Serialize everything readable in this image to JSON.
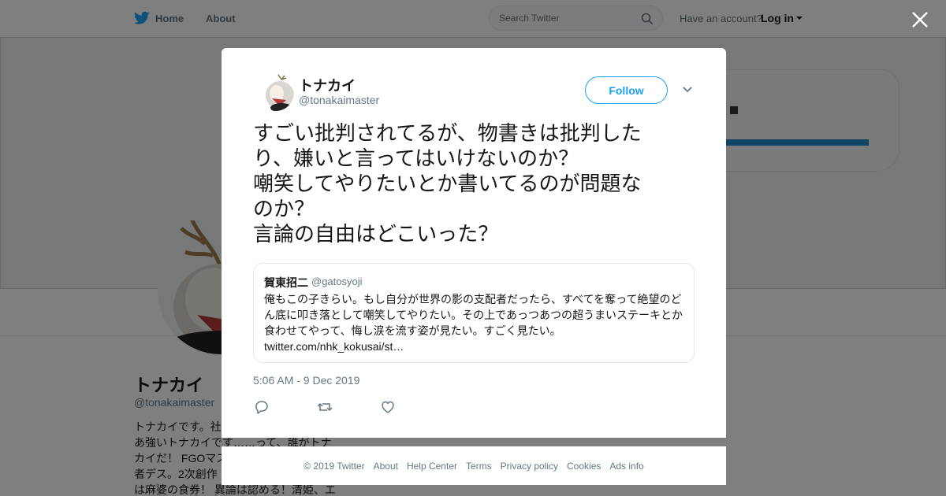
{
  "nav": {
    "home_label": "Home",
    "about_label": "About",
    "search_placeholder": "Search Twitter",
    "have_account": "Have an account?",
    "login_label": "Log in"
  },
  "profile": {
    "name": "トナカイ",
    "handle": "@tonakaimaster",
    "bio_lines": [
      "トナカイです。社",
      "あ強いトナカイです……って、誰がトナ",
      "カイだ！ FGOマス",
      "者デス。2次創作",
      "は麻婆の食券！ 異論は認める！清姫、エ"
    ]
  },
  "tweet": {
    "author_name": "トナカイ",
    "author_handle": "@tonakaimaster",
    "follow_label": "Follow",
    "text_lines": [
      "すごい批判されてるが、物書きは批判した",
      "り、嫌いと言ってはいけないのか？",
      "嘲笑してやりたいとか書いてるのが問題な",
      "のか？",
      "言論の自由はどこいった？"
    ],
    "timestamp": "5:06 AM - 9 Dec 2019"
  },
  "quoted": {
    "name": "賀東招二",
    "handle": "@gatosyoji",
    "text_lines": [
      "俺もこの子きらい。もし自分が世界の影の支配者だったら、すべてを奪って絶望のど",
      "ん底に叩き落として嘲笑してやりたい。その上であっつあつの超うまいステーキとか",
      "食わせてやって、悔し涙を流す姿が見たい。すごく見たい。",
      "twitter.com/nhk_kokusai/st…"
    ]
  },
  "footer": {
    "links": [
      "© 2019 Twitter",
      "About",
      "Help Center",
      "Terms",
      "Privacy policy",
      "Cookies",
      "Ads info"
    ]
  },
  "colors": {
    "accent": "#1da1f2",
    "secondary_text": "#657786",
    "overlay": "rgba(0,0,0,0.5)"
  },
  "icons": {
    "nav": "twitter-bird-icon",
    "search": "search-icon",
    "close": "close-icon",
    "more": "chevron-down-icon",
    "reply": "reply-icon",
    "retweet": "retweet-icon",
    "like": "heart-icon"
  }
}
